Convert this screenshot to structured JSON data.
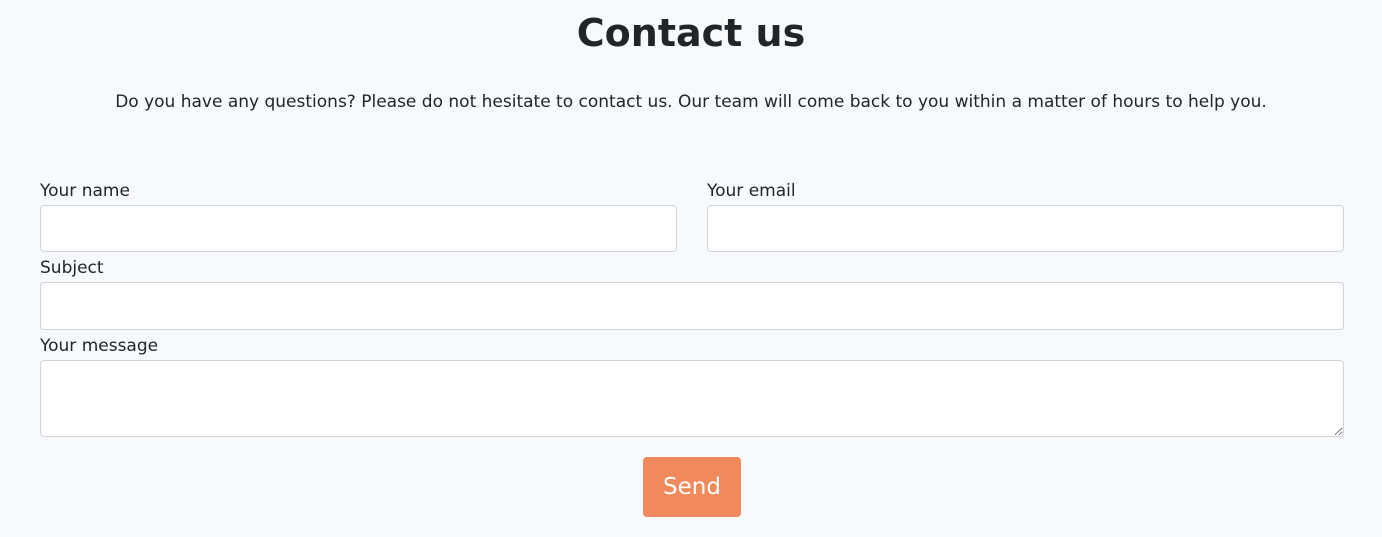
{
  "contact": {
    "title": "Contact us",
    "intro": "Do you have any questions? Please do not hesitate to contact us. Our team will come back to you within a matter of hours to help you.",
    "form": {
      "name_label": "Your name",
      "name_value": "",
      "email_label": "Your email",
      "email_value": "",
      "subject_label": "Subject",
      "subject_value": "",
      "message_label": "Your message",
      "message_value": "",
      "send_label": "Send"
    }
  },
  "colors": {
    "page_background": "#f8f9fa",
    "send_button": "#f08a5d",
    "input_border": "#ced4da"
  }
}
